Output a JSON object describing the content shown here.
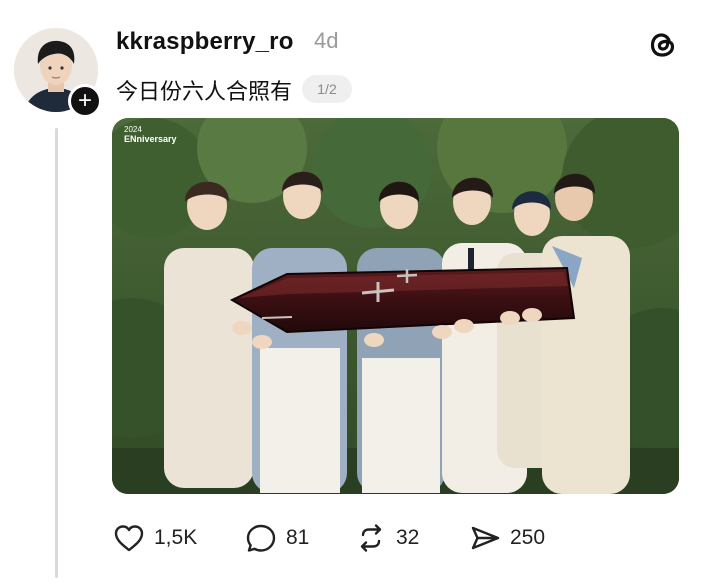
{
  "post": {
    "username": "kkraspberry_ro",
    "timestamp": "4d",
    "text": "今日份六人合照有",
    "page_indicator": "1/2",
    "image_watermark_lines": [
      "2024",
      "ENniversary"
    ]
  },
  "actions": {
    "likes": "1,5K",
    "replies": "81",
    "reposts": "32",
    "shares": "250"
  },
  "icons": {
    "app_logo": "threads-icon",
    "like": "heart-icon",
    "reply": "comment-bubble-icon",
    "repost": "repost-icon",
    "share": "send-icon"
  },
  "colors": {
    "text": "#111111",
    "muted": "#9a9a9a",
    "thread_line": "#d9d9d9"
  }
}
